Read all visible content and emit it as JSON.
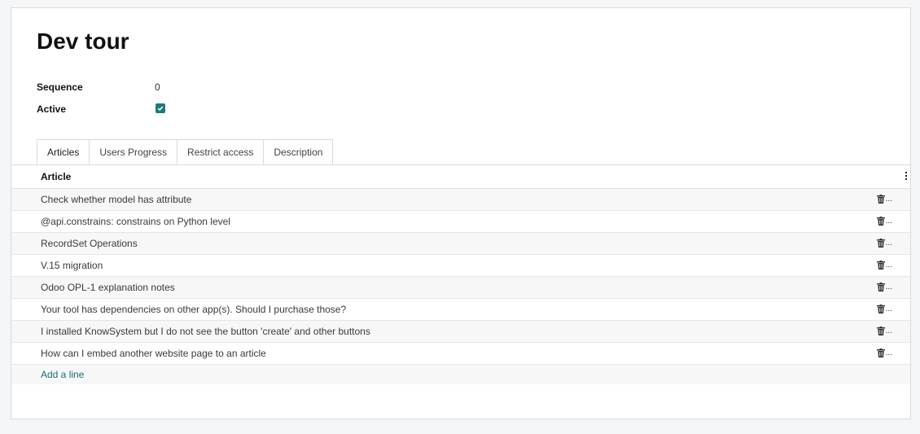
{
  "record": {
    "title": "Dev tour",
    "fields": {
      "sequence_label": "Sequence",
      "sequence_value": "0",
      "active_label": "Active",
      "active_checked": true
    }
  },
  "tabs": [
    {
      "label": "Articles",
      "active": true
    },
    {
      "label": "Users Progress",
      "active": false
    },
    {
      "label": "Restrict access",
      "active": false
    },
    {
      "label": "Description",
      "active": false
    }
  ],
  "table": {
    "column_header": "Article",
    "rows": [
      "Check whether model has attribute",
      "@api.constrains: constrains on Python level",
      "RecordSet Operations",
      "V.15 migration",
      "Odoo OPL-1 explanation notes",
      "Your tool has dependencies on other app(s). Should I purchase those?",
      "I installed KnowSystem but I do not see the button 'create' and other buttons",
      "How can I embed another website page to an article"
    ],
    "row_action_icon": "trash-icon",
    "row_action_overflow": "...",
    "add_line_label": "Add a line"
  },
  "colors": {
    "accent": "#1d7b7b",
    "link": "#1d6f7a"
  }
}
